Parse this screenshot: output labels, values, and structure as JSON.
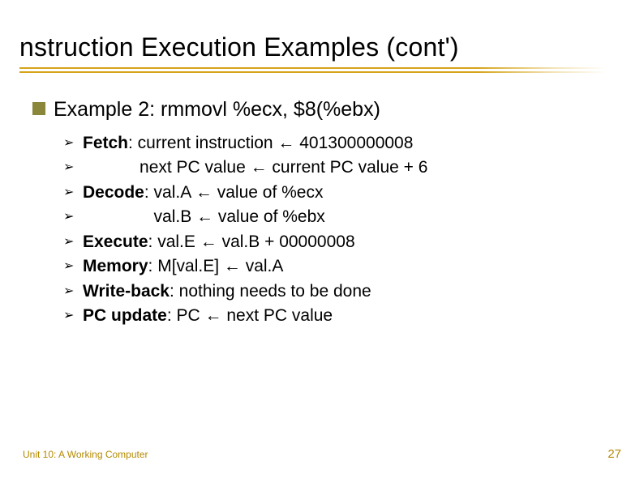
{
  "title": "nstruction Execution Examples (cont')",
  "example": {
    "label_prefix": "Example 2: ",
    "code": "rmmovl %ecx, $8(%ebx)"
  },
  "steps": [
    {
      "bold": "Fetch",
      "rest": ": current instruction ← 401300000008"
    },
    {
      "bold": "",
      "rest": "            next PC value ← current PC value + 6"
    },
    {
      "bold": "Decode",
      "rest": ": val.A ← value of %ecx"
    },
    {
      "bold": "",
      "rest": "               val.B ← value of %ebx"
    },
    {
      "bold": "Execute",
      "rest": ": val.E ← val.B + 00000008"
    },
    {
      "bold": "Memory",
      "rest": ": M[val.E] ← val.A"
    },
    {
      "bold": "Write-back",
      "rest": ": nothing needs to be done"
    },
    {
      "bold": "PC update",
      "rest": ": PC ← next PC value"
    }
  ],
  "footer": {
    "unit": "Unit 10: A Working Computer",
    "page": "27"
  }
}
